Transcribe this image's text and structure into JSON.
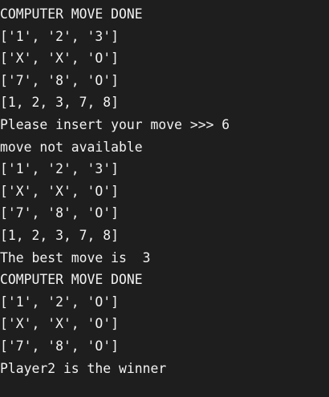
{
  "terminal": {
    "lines": [
      "COMPUTER MOVE DONE",
      "['1', '2', '3']",
      "['X', 'X', 'O']",
      "['7', '8', 'O']",
      "[1, 2, 3, 7, 8]",
      "Please insert your move >>> 6",
      "move not available",
      "['1', '2', '3']",
      "['X', 'X', 'O']",
      "['7', '8', 'O']",
      "[1, 2, 3, 7, 8]",
      "The best move is  3",
      "COMPUTER MOVE DONE",
      "['1', '2', 'O']",
      "['X', 'X', 'O']",
      "['7', '8', 'O']",
      "Player2 is the winner"
    ],
    "colors": {
      "background": "#1e1e1e",
      "text": "#f2f2f2"
    }
  }
}
